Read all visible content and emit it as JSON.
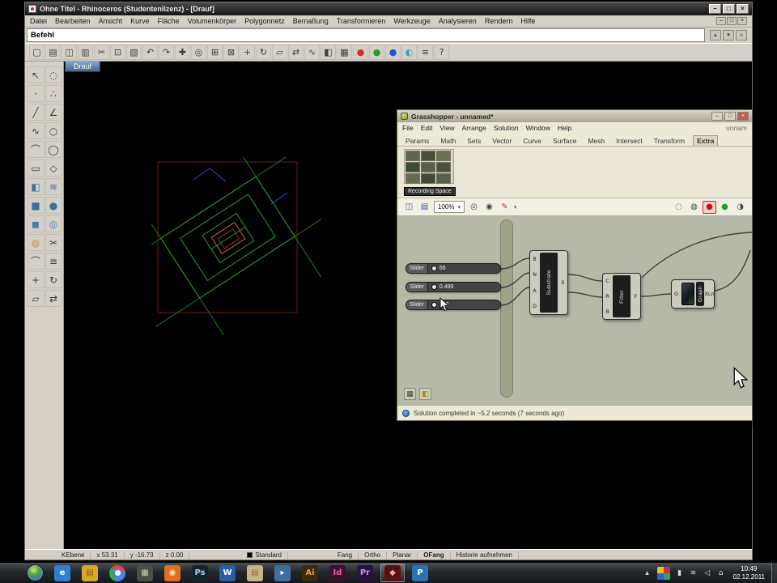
{
  "colors": {
    "chrome": "#d4d0c8",
    "gh-canvas": "#b6b9a7",
    "gh-group": "#9da289",
    "record-red": "#c41414",
    "preview-green": "#2a9e2a"
  },
  "window": {
    "title": "Ohne Titel - Rhinoceros (Studentenlizenz) - [Drauf]",
    "controls": [
      {
        "name": "minimize-button",
        "glyph": "–"
      },
      {
        "name": "maximize-button",
        "glyph": "□"
      },
      {
        "name": "close-button",
        "glyph": "×"
      }
    ],
    "mdi_controls": [
      {
        "name": "mdi-minimize-button",
        "glyph": "–"
      },
      {
        "name": "mdi-restore-button",
        "glyph": "□"
      },
      {
        "name": "mdi-close-button",
        "glyph": "×"
      }
    ]
  },
  "menubar": {
    "items": [
      "Datei",
      "Bearbeiten",
      "Ansicht",
      "Kurve",
      "Fläche",
      "Volumenkörper",
      "Polygonnetz",
      "Bemaßung",
      "Transformieren",
      "Werkzeuge",
      "Analysieren",
      "Rendern",
      "Hilfe"
    ]
  },
  "command_area": {
    "prompt": "Befehl",
    "buttons": [
      {
        "name": "scroll-up-icon",
        "glyph": "▴"
      },
      {
        "name": "scroll-down-icon",
        "glyph": "▾"
      },
      {
        "name": "expand-icon",
        "glyph": "»"
      }
    ]
  },
  "toolbar": {
    "icons": [
      {
        "name": "new-file-icon",
        "glyph": "▢"
      },
      {
        "name": "open-file-icon",
        "glyph": "▤"
      },
      {
        "name": "save-icon",
        "glyph": "◫"
      },
      {
        "name": "print-icon",
        "glyph": "▥"
      },
      {
        "name": "cut-icon",
        "glyph": "✂"
      },
      {
        "name": "copy-icon",
        "glyph": "⊡"
      },
      {
        "name": "paste-icon",
        "glyph": "▧"
      },
      {
        "name": "undo-icon",
        "glyph": "↶"
      },
      {
        "name": "redo-icon",
        "glyph": "↷"
      },
      {
        "name": "pan-icon",
        "glyph": "✚"
      },
      {
        "name": "zoom-dynamic-icon",
        "glyph": "◎"
      },
      {
        "name": "zoom-window-icon",
        "glyph": "⊞"
      },
      {
        "name": "zoom-extents-icon",
        "glyph": "⊠"
      },
      {
        "name": "move-icon",
        "glyph": "+"
      },
      {
        "name": "rotate-icon",
        "glyph": "↻"
      },
      {
        "name": "scale-icon",
        "glyph": "▱"
      },
      {
        "name": "mirror-icon",
        "glyph": "⇄"
      },
      {
        "name": "curve-tool-icon",
        "glyph": "∿"
      },
      {
        "name": "surface-tool-icon",
        "glyph": "◧"
      },
      {
        "name": "mesh-tool-icon",
        "glyph": "▦"
      },
      {
        "name": "render-red-icon",
        "glyph": "●",
        "color": "#cc3322"
      },
      {
        "name": "render-green-icon",
        "glyph": "●",
        "color": "#2a9e2a"
      },
      {
        "name": "render-blue-icon",
        "glyph": "●",
        "color": "#2255cc"
      },
      {
        "name": "shaded-view-icon",
        "glyph": "◐",
        "color": "#2aa5c0"
      },
      {
        "name": "layers-icon",
        "glyph": "≡"
      },
      {
        "name": "help-icon",
        "glyph": "?"
      }
    ]
  },
  "left_toolbar": {
    "icons": [
      {
        "name": "select-arrow-icon",
        "glyph": "↖"
      },
      {
        "name": "selection-brush-icon",
        "glyph": "◌"
      },
      {
        "name": "point-icon",
        "glyph": "·"
      },
      {
        "name": "point-cloud-icon",
        "glyph": "∴"
      },
      {
        "name": "line-icon",
        "glyph": "╱"
      },
      {
        "name": "polyline-icon",
        "glyph": "∠"
      },
      {
        "name": "curve-icon",
        "glyph": "∿"
      },
      {
        "name": "circle-icon",
        "glyph": "○"
      },
      {
        "name": "arc-icon",
        "glyph": "⌒"
      },
      {
        "name": "ellipse-icon",
        "glyph": "◯"
      },
      {
        "name": "rectangle-icon",
        "glyph": "▭"
      },
      {
        "name": "polygon-icon",
        "glyph": "◇"
      },
      {
        "name": "surface-icon",
        "glyph": "◧",
        "color": "#3a6ea5"
      },
      {
        "name": "loft-icon",
        "glyph": "≋",
        "color": "#3a6ea5"
      },
      {
        "name": "box-icon",
        "glyph": "■",
        "color": "#3a6ea5"
      },
      {
        "name": "sphere-icon",
        "glyph": "●",
        "color": "#3a6ea5"
      },
      {
        "name": "cylinder-icon",
        "glyph": "◼",
        "color": "#4a7ab5"
      },
      {
        "name": "torus-icon",
        "glyph": "◎",
        "color": "#4a7ab5"
      },
      {
        "name": "boolean-union-icon",
        "glyph": "◍",
        "color": "#c89a2a"
      },
      {
        "name": "trim-icon",
        "glyph": "✂"
      },
      {
        "name": "fillet-icon",
        "glyph": "⌒"
      },
      {
        "name": "offset-icon",
        "glyph": "≡"
      },
      {
        "name": "move-icon",
        "glyph": "+"
      },
      {
        "name": "rotate-icon",
        "glyph": "↻"
      },
      {
        "name": "scale-icon",
        "glyph": "▱"
      },
      {
        "name": "mirror-icon",
        "glyph": "⇄"
      }
    ]
  },
  "viewport": {
    "tab_label": "Drauf"
  },
  "grasshopper": {
    "title": "Grasshopper - unnamed*",
    "filename_hint": "unnam",
    "controls": [
      {
        "name": "gh-minimize-button",
        "glyph": "–"
      },
      {
        "name": "gh-maximize-button",
        "glyph": "□"
      },
      {
        "name": "gh-close-button",
        "glyph": "×",
        "kind": "close"
      }
    ],
    "menus": [
      "File",
      "Edit",
      "View",
      "Arrange",
      "Solution",
      "Window",
      "Help"
    ],
    "tabs": [
      {
        "label": "Params"
      },
      {
        "label": "Math"
      },
      {
        "label": "Sets"
      },
      {
        "label": "Vector"
      },
      {
        "label": "Curve"
      },
      {
        "label": "Surface"
      },
      {
        "label": "Mesh"
      },
      {
        "label": "Intersect"
      },
      {
        "label": "Transform"
      },
      {
        "label": "Extra",
        "active": true
      }
    ],
    "panel_label": "Recording Space",
    "palette_icons": [
      {
        "name": "extra-component-icon",
        "color": "#5f664c"
      },
      {
        "name": "extra-component-icon",
        "color": "#474f3a"
      },
      {
        "name": "extra-component-icon",
        "color": "#6b7254"
      },
      {
        "name": "extra-component-icon",
        "color": "#3f4a38"
      },
      {
        "name": "extra-component-icon",
        "color": "#596046"
      },
      {
        "name": "extra-component-icon",
        "color": "#4a523c"
      },
      {
        "name": "extra-component-icon",
        "color": "#656c50"
      },
      {
        "name": "extra-component-icon",
        "color": "#424a36"
      },
      {
        "name": "extra-component-icon",
        "color": "#57604a"
      }
    ],
    "canvas_toolbar": {
      "zoom": "100%",
      "dropdown_glyph": "▾",
      "file_icons": [
        {
          "name": "save-definition-icon",
          "glyph": "◫",
          "color": "#2a5fa8"
        },
        {
          "name": "open-definition-icon",
          "glyph": "▤",
          "color": "#2a5fa8"
        }
      ],
      "view_icons": [
        {
          "name": "zoom-focus-icon",
          "glyph": "◎"
        },
        {
          "name": "preview-eye-icon",
          "glyph": "◉"
        },
        {
          "name": "sketch-pen-icon",
          "glyph": "✎",
          "color": "#a33a2a"
        }
      ],
      "right_icons": [
        {
          "name": "preview-wireframe-icon",
          "glyph": "◌"
        },
        {
          "name": "preview-mesh-icon",
          "glyph": "◍"
        },
        {
          "name": "record-data-icon",
          "glyph": "●",
          "color": "#c41414",
          "active": true
        },
        {
          "name": "preview-on-icon",
          "glyph": "●",
          "color": "#2a9e2a"
        },
        {
          "name": "clipped-view-icon",
          "glyph": "◑"
        }
      ]
    },
    "canvas": {
      "sliders": [
        {
          "label": "Slider",
          "value": "66"
        },
        {
          "label": "Slider",
          "value": "0.490"
        },
        {
          "label": "Slider",
          "value": "110"
        }
      ],
      "nodes": [
        {
          "name": "Substrate",
          "inputs": [
            "B",
            "N",
            "A",
            "D"
          ],
          "outputs": [
            "S"
          ]
        },
        {
          "name": "Filter",
          "inputs": [
            "C",
            "R",
            "B"
          ],
          "outputs": [
            "F"
          ]
        },
        {
          "name": "Graph",
          "inputs": [
            "G"
          ],
          "outputs": [
            "XLn"
          ]
        }
      ],
      "corner_icons": [
        {
          "name": "profiler-grid-icon",
          "glyph": "▦",
          "color": "#3f4435"
        },
        {
          "name": "paint-bucket-icon",
          "glyph": "◧",
          "color": "#b97f14"
        }
      ]
    },
    "status": "Solution completed in ~5.2 seconds (7 seconds ago)"
  },
  "rhino_status": {
    "cplane_label": "KEbene",
    "coords": {
      "x": "x 53.31",
      "y": "y -16.73",
      "z": "z 0.00"
    },
    "layer": "Standard",
    "toggles": [
      {
        "label": "Fang"
      },
      {
        "label": "Ortho"
      },
      {
        "label": "Planar"
      },
      {
        "label": "OFang",
        "active": true
      },
      {
        "label": "Historie aufnehmen"
      }
    ]
  },
  "taskbar": {
    "apps": [
      {
        "name": "start-button",
        "kind": "orb",
        "glyph": ""
      },
      {
        "name": "internet-explorer-icon",
        "glyph": "e",
        "color": "#2f7fd4",
        "fg": "#ffffff"
      },
      {
        "name": "windows-explorer-icon",
        "glyph": "▤",
        "color": "#d9a826",
        "fg": "#7a5a10"
      },
      {
        "name": "chrome-icon",
        "kind": "chrome",
        "glyph": ""
      },
      {
        "name": "media-app-icon",
        "glyph": "▦",
        "color": "#4a4f44",
        "fg": "#c9d0c0"
      },
      {
        "name": "firefox-icon",
        "glyph": "◉",
        "color": "#e07020",
        "fg": "#fff3d0"
      },
      {
        "name": "photoshop-icon",
        "glyph": "Ps",
        "color": "#13252e",
        "fg": "#9fd2ef"
      },
      {
        "name": "word-icon",
        "glyph": "W",
        "color": "#2a5ca8",
        "fg": "#ffffff"
      },
      {
        "name": "folder-icon",
        "glyph": "▤",
        "color": "#c9b489",
        "fg": "#8a6d2f"
      },
      {
        "name": "media-player-icon",
        "glyph": "▸",
        "color": "#3f6f9e",
        "fg": "#ffffff"
      },
      {
        "name": "illustrator-icon",
        "glyph": "Ai",
        "color": "#3a2a12",
        "fg": "#f0a02a"
      },
      {
        "name": "indesign-icon",
        "glyph": "Id",
        "color": "#3a1230",
        "fg": "#ef5fa0"
      },
      {
        "name": "premiere-icon",
        "glyph": "Pr",
        "color": "#2a1240",
        "fg": "#b99af0"
      },
      {
        "name": "active-app-icon",
        "glyph": "◆",
        "color": "#5a1010",
        "fg": "#e0b0a0",
        "active": true
      },
      {
        "name": "pdf-app-icon",
        "glyph": "P",
        "color": "#2a72b8",
        "fg": "#ffffff"
      }
    ],
    "tray": [
      {
        "name": "hidden-icons-icon",
        "glyph": "▴"
      },
      {
        "name": "color-grid-icon",
        "kind": "colorgrid",
        "glyph": ""
      },
      {
        "name": "battery-icon",
        "glyph": "▮"
      },
      {
        "name": "network-icon",
        "glyph": "≋"
      },
      {
        "name": "volume-icon",
        "glyph": "◁"
      },
      {
        "name": "action-center-icon",
        "glyph": "⌂"
      }
    ],
    "clock": {
      "time": "10:49",
      "date": "02.12.2011"
    }
  }
}
